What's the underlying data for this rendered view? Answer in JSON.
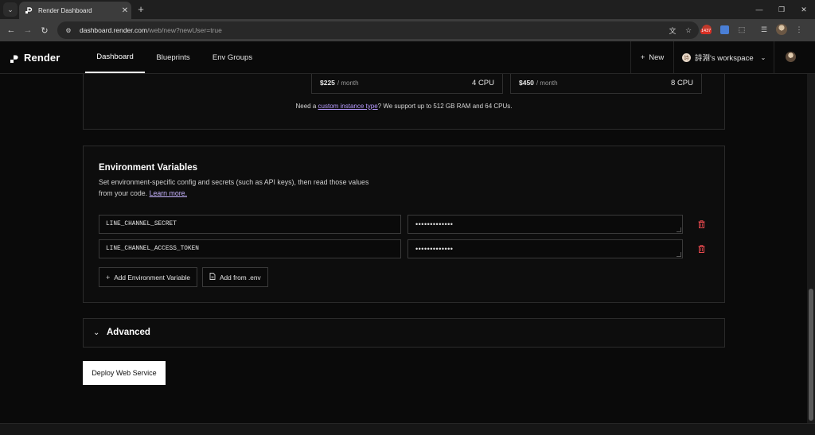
{
  "browser": {
    "tab_title": "Render Dashboard",
    "url_host": "dashboard.render.com",
    "url_path": "/web/new?newUser=true",
    "extension_badge": "1437"
  },
  "header": {
    "brand": "Render",
    "nav": [
      "Dashboard",
      "Blueprints",
      "Env Groups"
    ],
    "active_nav": "Dashboard",
    "new_label": "New",
    "workspace_label": "詩淵's workspace",
    "workspace_initial": "詩"
  },
  "instances": [
    {
      "price": "$225",
      "per": "/ month",
      "cpu": "4 CPU"
    },
    {
      "price": "$450",
      "per": "/ month",
      "cpu": "8 CPU"
    }
  ],
  "instance_note": {
    "prefix": "Need a ",
    "link": "custom instance type",
    "suffix": "? We support up to 512 GB RAM and 64 CPUs."
  },
  "env": {
    "title": "Environment Variables",
    "description": "Set environment-specific config and secrets (such as API keys), then read those values from your code.",
    "learn_more": "Learn more.",
    "vars": [
      {
        "key": "LINE_CHANNEL_SECRET",
        "value": "•••••••••••••"
      },
      {
        "key": "LINE_CHANNEL_ACCESS_TOKEN",
        "value": "•••••••••••••"
      }
    ],
    "add_button": "Add Environment Variable",
    "add_from_env": "Add from .env"
  },
  "advanced": {
    "title": "Advanced"
  },
  "deploy_button": "Deploy Web Service",
  "colors": {
    "accent_link": "#b89cff",
    "danger_icon": "#e5484d",
    "background": "#0a0a0a"
  }
}
